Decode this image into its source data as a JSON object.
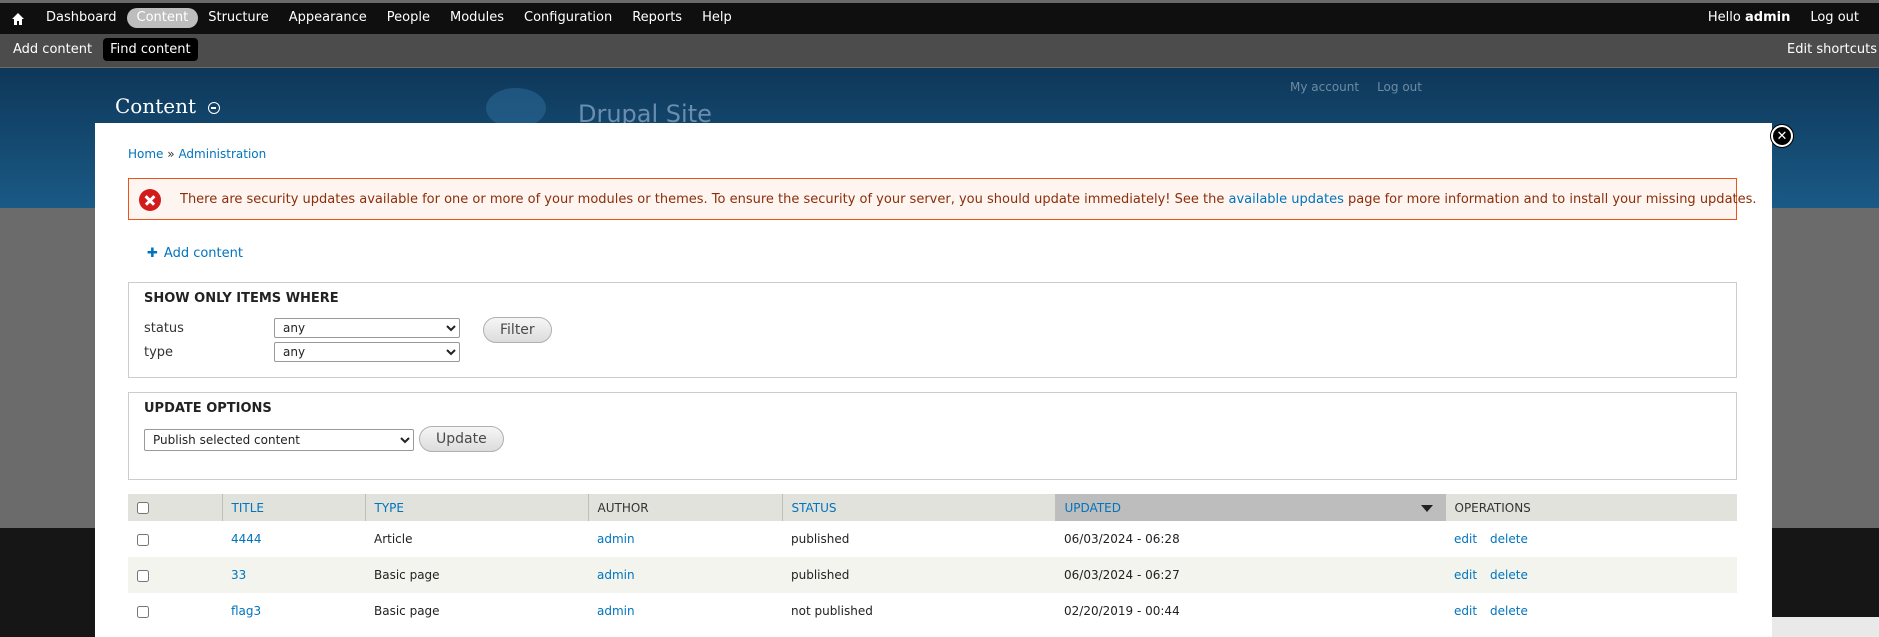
{
  "toolbar": {
    "home_icon": "home-icon",
    "menu": [
      {
        "label": "Dashboard",
        "active": false
      },
      {
        "label": "Content",
        "active": true
      },
      {
        "label": "Structure",
        "active": false
      },
      {
        "label": "Appearance",
        "active": false
      },
      {
        "label": "People",
        "active": false
      },
      {
        "label": "Modules",
        "active": false
      },
      {
        "label": "Configuration",
        "active": false
      },
      {
        "label": "Reports",
        "active": false
      },
      {
        "label": "Help",
        "active": false
      }
    ],
    "hello": "Hello",
    "username": "admin",
    "logout": "Log out"
  },
  "shortcuts": {
    "items": [
      {
        "label": "Add content",
        "active": false
      },
      {
        "label": "Find content",
        "active": true
      }
    ],
    "edit_label": "Edit shortcuts"
  },
  "background": {
    "site_name": "Drupal Site",
    "my_account": "My account",
    "log_out": "Log out"
  },
  "overlay": {
    "title": "Content",
    "close_icon": "close-icon"
  },
  "breadcrumb": {
    "home": "Home",
    "separator": "»",
    "admin": "Administration"
  },
  "message": {
    "before": "There are security updates available for one or more of your modules or themes. To ensure the security of your server, you should update immediately! See the ",
    "link": "available updates",
    "after": " page for more information and to install your missing updates."
  },
  "actions": {
    "add_content": "Add content"
  },
  "filter": {
    "legend": "SHOW ONLY ITEMS WHERE",
    "status_label": "status",
    "status_value": "any",
    "type_label": "type",
    "type_value": "any",
    "button": "Filter"
  },
  "update": {
    "legend": "UPDATE OPTIONS",
    "operation_value": "Publish selected content",
    "button": "Update"
  },
  "table": {
    "headers": {
      "title": "TITLE",
      "type": "TYPE",
      "author": "AUTHOR",
      "status": "STATUS",
      "updated": "UPDATED",
      "operations": "OPERATIONS"
    },
    "sorted_column": "updated",
    "rows": [
      {
        "title": "4444",
        "type": "Article",
        "author": "admin",
        "status": "published",
        "updated": "06/03/2024 - 06:28",
        "edit": "edit",
        "delete": "delete"
      },
      {
        "title": "33",
        "type": "Basic page",
        "author": "admin",
        "status": "published",
        "updated": "06/03/2024 - 06:27",
        "edit": "edit",
        "delete": "delete"
      },
      {
        "title": "flag3",
        "type": "Basic page",
        "author": "admin",
        "status": "not published",
        "updated": "02/20/2019 - 00:44",
        "edit": "edit",
        "delete": "delete"
      }
    ]
  }
}
